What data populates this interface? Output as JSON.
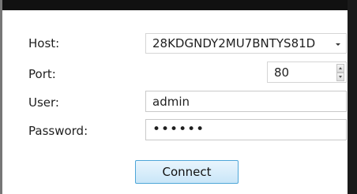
{
  "form": {
    "host": {
      "label": "Host:",
      "value": "28KDGNDY2MU7BNTYS81D"
    },
    "port": {
      "label": "Port:",
      "value": "80"
    },
    "user": {
      "label": "User:",
      "value": "admin"
    },
    "password": {
      "label": "Password:",
      "value": "••••••"
    },
    "connect_label": "Connect"
  },
  "icons": {
    "dropdown": "chevron-down-icon",
    "spin_up": "arrow-up-icon",
    "spin_down": "arrow-down-icon"
  }
}
